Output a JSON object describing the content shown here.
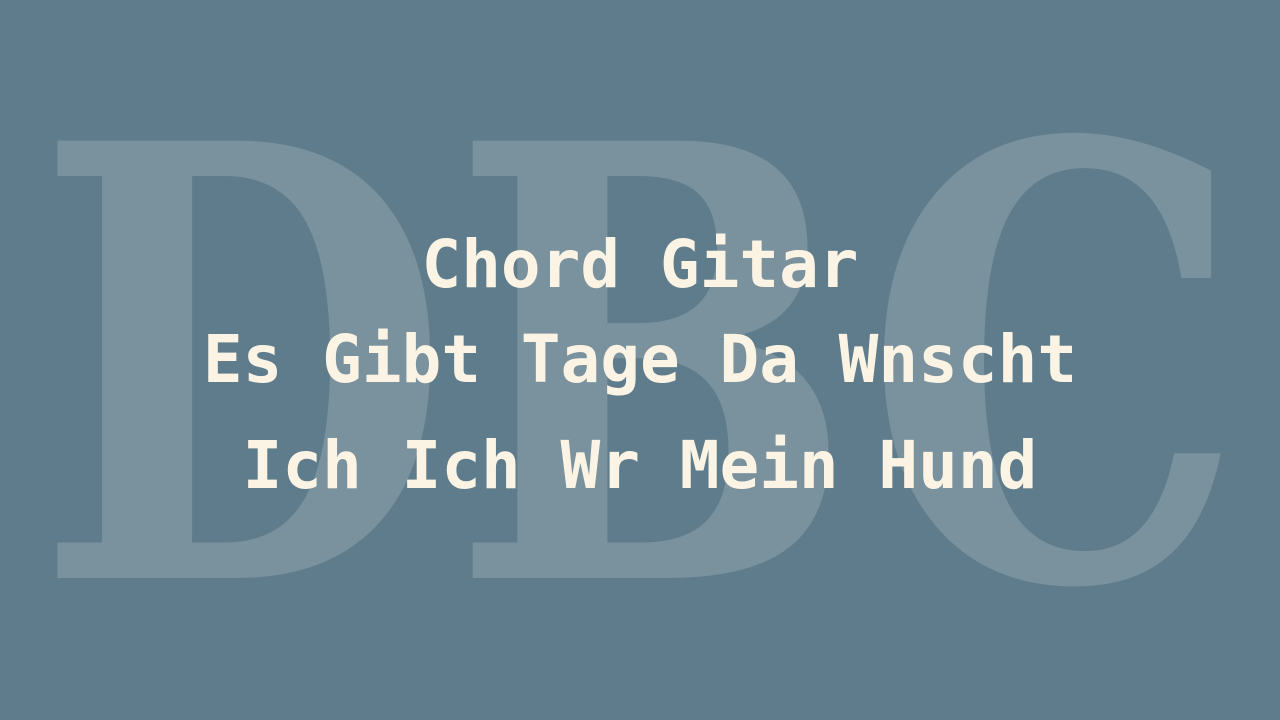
{
  "background_color": "#5f7c8c",
  "watermark": {
    "text": "DBC",
    "color": "#7a919e"
  },
  "title": {
    "color": "#fbf4e4",
    "lines": [
      "Chord Gitar",
      "Es Gibt Tage Da Wnscht",
      "Ich Ich Wr Mein Hund"
    ]
  }
}
